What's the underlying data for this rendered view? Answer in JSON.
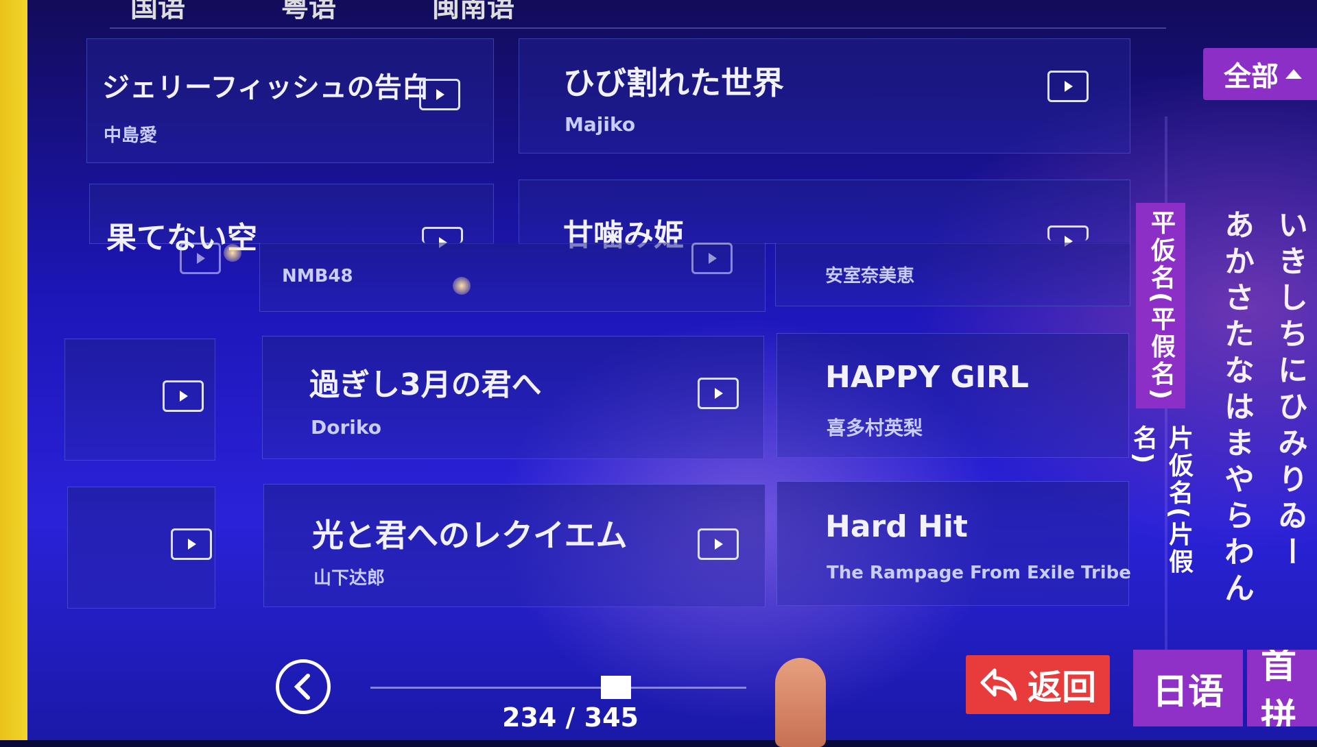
{
  "top_tabs": [
    "国语",
    "粤语",
    "闽南语"
  ],
  "songs": [
    {
      "title": "ジェリーフィッシュの告白",
      "artist": "中島愛"
    },
    {
      "title": "ひび割れた世界",
      "artist": "Majiko"
    },
    {
      "title": "果てない空",
      "artist": "NMB48"
    },
    {
      "title": "甘噛み姫",
      "artist": "安室奈美恵"
    },
    {
      "title": "過ぎし3月の君へ",
      "artist": "Doriko"
    },
    {
      "title": "HAPPY GIRL",
      "artist": "喜多村英梨"
    },
    {
      "title": "光と君へのレクイエム",
      "artist": "山下达郎"
    },
    {
      "title": "Hard Hit",
      "artist": "The Rampage From Exile Tribe"
    }
  ],
  "filter": {
    "label": "全部"
  },
  "kana_tabs": {
    "hiragana": "平仮名(平假名)",
    "katakana": "片仮名(片假名)"
  },
  "kana_columns": [
    "あかさたなはまやらわん",
    "いきしちにひみりゐー"
  ],
  "language_tabs": [
    "日语",
    "首拼"
  ],
  "pager": {
    "current": "234",
    "total": "345",
    "text": "234 / 345",
    "position": 0.68
  },
  "back_button": {
    "label": "返回"
  },
  "colors": {
    "accent_purple": "#8b2fc6",
    "back_red": "#e83c3c",
    "background_blue": "#1d16b8"
  }
}
